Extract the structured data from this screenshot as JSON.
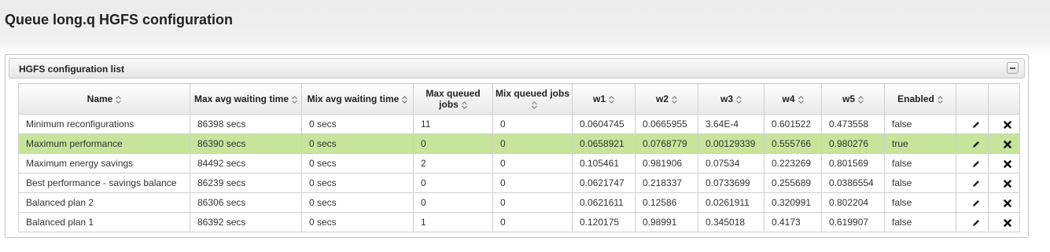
{
  "page": {
    "title": "Queue long.q HGFS configuration"
  },
  "panel": {
    "title": "HGFS configuration list"
  },
  "table": {
    "columns": [
      {
        "label": "Name",
        "sortable": true
      },
      {
        "label": "Max avg waiting time",
        "sortable": true
      },
      {
        "label": "Mix avg waiting time",
        "sortable": true
      },
      {
        "label": "Max queued jobs",
        "sortable": true
      },
      {
        "label": "Mix queued jobs",
        "sortable": true
      },
      {
        "label": "w1",
        "sortable": true
      },
      {
        "label": "w2",
        "sortable": true
      },
      {
        "label": "w3",
        "sortable": true
      },
      {
        "label": "w4",
        "sortable": true
      },
      {
        "label": "w5",
        "sortable": true
      },
      {
        "label": "Enabled",
        "sortable": true
      },
      {
        "label": "",
        "sortable": false
      },
      {
        "label": "",
        "sortable": false
      }
    ],
    "selected_row_index": 1,
    "rows": [
      {
        "name": "Minimum reconfigurations",
        "max_wait": "86398 secs",
        "mix_wait": "0 secs",
        "max_jobs": "11",
        "mix_jobs": "0",
        "w1": "0.0604745",
        "w2": "0.0665955",
        "w3": "3.64E-4",
        "w4": "0.601522",
        "w5": "0.473558",
        "enabled": "false"
      },
      {
        "name": "Maximum performance",
        "max_wait": "86390 secs",
        "mix_wait": "0 secs",
        "max_jobs": "0",
        "mix_jobs": "0",
        "w1": "0.0658921",
        "w2": "0.0768779",
        "w3": "0.00129339",
        "w4": "0.555766",
        "w5": "0.980276",
        "enabled": "true"
      },
      {
        "name": "Maximum energy savings",
        "max_wait": "84492 secs",
        "mix_wait": "0 secs",
        "max_jobs": "2",
        "mix_jobs": "0",
        "w1": "0.105461",
        "w2": "0.981906",
        "w3": "0.07534",
        "w4": "0.223269",
        "w5": "0.801569",
        "enabled": "false"
      },
      {
        "name": "Best performance - savings balance",
        "max_wait": "86239 secs",
        "mix_wait": "0 secs",
        "max_jobs": "0",
        "mix_jobs": "0",
        "w1": "0.0621747",
        "w2": "0.218337",
        "w3": "0.0733699",
        "w4": "0.255689",
        "w5": "0.0386554",
        "enabled": "false"
      },
      {
        "name": "Balanced plan 2",
        "max_wait": "86306 secs",
        "mix_wait": "0 secs",
        "max_jobs": "0",
        "mix_jobs": "0",
        "w1": "0.0621611",
        "w2": "0.12586",
        "w3": "0.0261911",
        "w4": "0.320991",
        "w5": "0.802204",
        "enabled": "false"
      },
      {
        "name": "Balanced plan 1",
        "max_wait": "86392 secs",
        "mix_wait": "0 secs",
        "max_jobs": "1",
        "mix_jobs": "0",
        "w1": "0.120175",
        "w2": "0.98991",
        "w3": "0.345018",
        "w4": "0.4173",
        "w5": "0.619907",
        "enabled": "false"
      }
    ]
  },
  "icons": {
    "edit": "pencil-icon",
    "delete": "x-icon",
    "sort": "sort-arrows-icon",
    "collapse": "minus-icon"
  },
  "colors": {
    "selected_row": "#c6e59a"
  }
}
